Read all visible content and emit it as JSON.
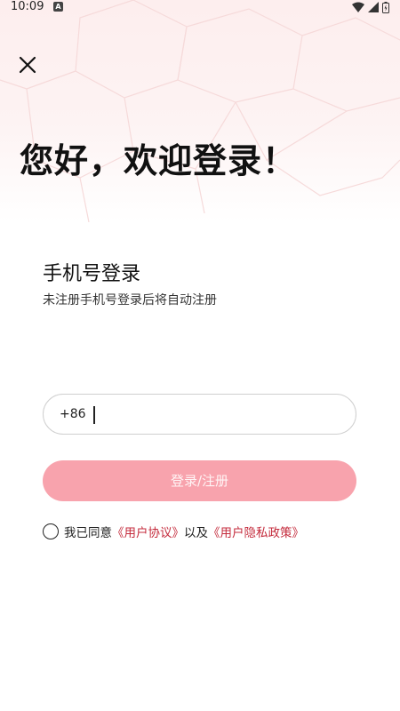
{
  "status_bar": {
    "time": "10:09",
    "notification_icon": "A",
    "icons": [
      "wifi-icon",
      "signal-icon",
      "battery-icon"
    ]
  },
  "header": {
    "close_icon": "close-icon",
    "greeting": "您好，欢迎登录！"
  },
  "login": {
    "title": "手机号登录",
    "subtitle": "未注册手机号登录后将自动注册",
    "country_code": "+86",
    "phone_value": "",
    "phone_placeholder": "",
    "submit_label": "登录/注册"
  },
  "agreement": {
    "prefix": "我已同意",
    "user_agreement": "《用户协议》",
    "conjunction": "以及",
    "privacy_policy": "《用户隐私政策》",
    "checked": false
  },
  "colors": {
    "accent": "#f8a3ad",
    "link": "#c42b3c",
    "hero_bg": "#fdeeee"
  }
}
